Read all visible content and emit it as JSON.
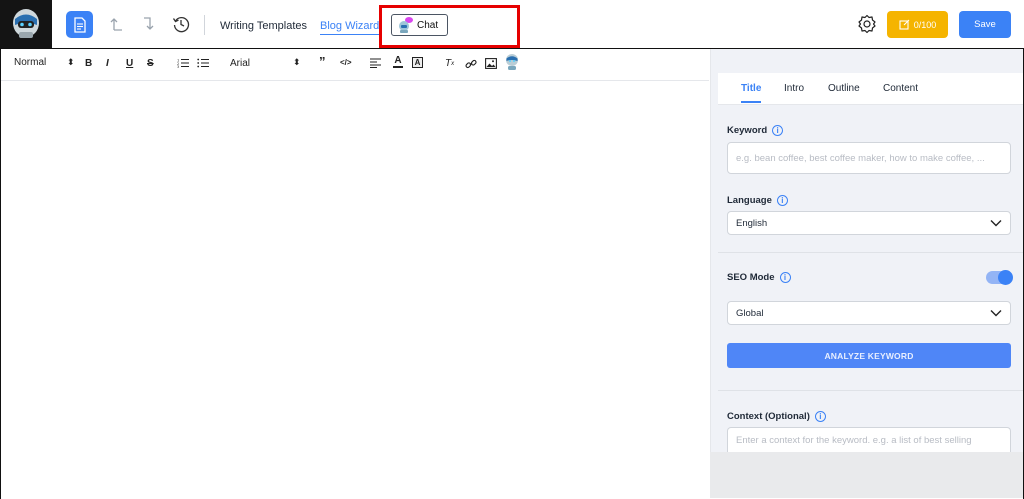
{
  "header": {
    "nav": {
      "writing_templates": "Writing Templates",
      "blog_wizard": "Blog Wizard"
    },
    "chat_button": "Chat",
    "credits": "0/100",
    "save": "Save"
  },
  "toolbar": {
    "heading_select": "Normal",
    "font_select": "Arial"
  },
  "panel": {
    "tabs": [
      "Title",
      "Intro",
      "Outline",
      "Content"
    ],
    "active_tab": "Title",
    "keyword": {
      "label": "Keyword",
      "placeholder": "e.g. bean coffee, best coffee maker, how to make coffee, ..."
    },
    "language": {
      "label": "Language",
      "value": "English"
    },
    "seo_mode": {
      "label": "SEO Mode",
      "enabled": true,
      "value": "Global"
    },
    "analyze_button": "ANALYZE KEYWORD",
    "context": {
      "label": "Context (Optional)",
      "placeholder": "Enter a context for the keyword. e.g. a list of best selling"
    }
  },
  "colors": {
    "accent": "#3b82f6",
    "credits": "#f5b400",
    "highlight": "#e60000",
    "panel_bg": "#f0f2f7"
  }
}
